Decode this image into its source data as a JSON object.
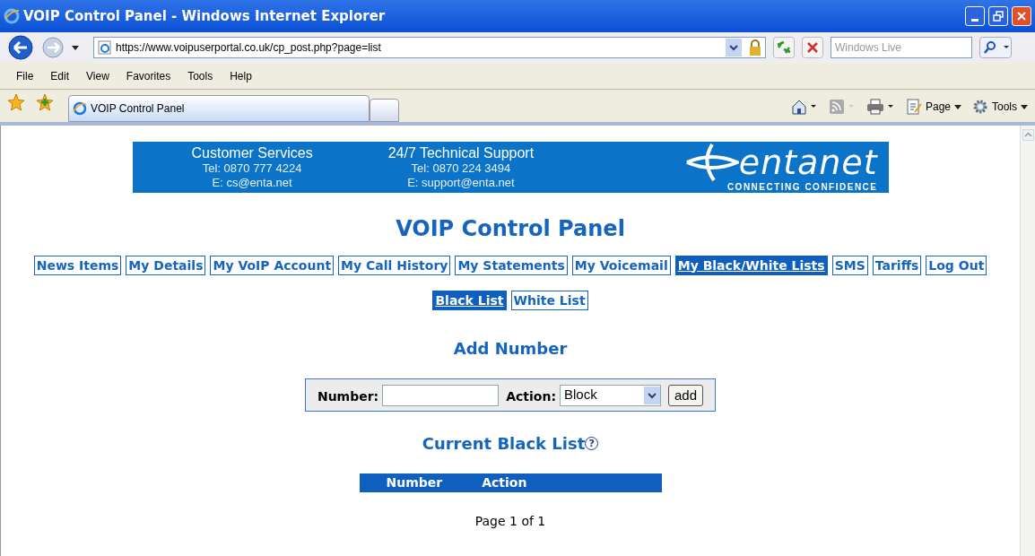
{
  "window": {
    "title": "VOIP Control Panel - Windows Internet Explorer"
  },
  "address_bar": {
    "url": "https://www.voipuserportal.co.uk/cp_post.php?page=list"
  },
  "search": {
    "placeholder": "Windows Live"
  },
  "menu": [
    "File",
    "Edit",
    "View",
    "Favorites",
    "Tools",
    "Help"
  ],
  "browser_tab": {
    "title": "VOIP Control Panel"
  },
  "command_bar": [
    "Page",
    "Tools"
  ],
  "banner": {
    "columns": [
      {
        "title": "Customer Services",
        "lines": [
          "Tel: 0870 777 4224",
          "E: cs@enta.net"
        ]
      },
      {
        "title": "24/7 Technical Support",
        "lines": [
          "Tel: 0870 224 3494",
          "E: support@enta.net"
        ]
      }
    ],
    "logo": "entanet",
    "tagline": "CONNECTING CONFIDENCE"
  },
  "page_title": "VOIP Control Panel",
  "nav": [
    {
      "label": "News Items",
      "selected": false
    },
    {
      "label": "My Details",
      "selected": false
    },
    {
      "label": "My VoIP Account",
      "selected": false
    },
    {
      "label": "My Call History",
      "selected": false
    },
    {
      "label": "My Statements",
      "selected": false
    },
    {
      "label": "My Voicemail",
      "selected": false
    },
    {
      "label": "My Black/White Lists",
      "selected": true
    },
    {
      "label": "SMS",
      "selected": false
    },
    {
      "label": "Tariffs",
      "selected": false
    },
    {
      "label": "Log Out",
      "selected": false
    }
  ],
  "subnav": [
    {
      "label": "Black List",
      "selected": true
    },
    {
      "label": "White List",
      "selected": false
    }
  ],
  "add_form": {
    "heading": "Add Number",
    "number_label": "Number:",
    "action_label": "Action:",
    "action_value": "Block",
    "button": "add"
  },
  "list": {
    "heading": "Current Black List",
    "help": "?",
    "columns": [
      "Number",
      "Action"
    ],
    "pagination": "Page 1 of 1"
  }
}
